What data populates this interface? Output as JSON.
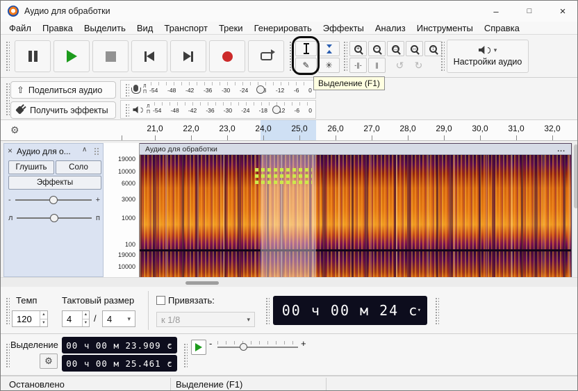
{
  "window": {
    "title": "Аудио для обработки",
    "minimize": "–",
    "maximize": "□",
    "close": "×"
  },
  "menu": {
    "items": [
      "Файл",
      "Правка",
      "Выделить",
      "Вид",
      "Транспорт",
      "Треки",
      "Генерировать",
      "Эффекты",
      "Анализ",
      "Инструменты",
      "Справка"
    ]
  },
  "toolbar": {
    "audio_setup": "Настройки аудио",
    "share_audio": "Поделиться аудио",
    "get_effects": "Получить эффекты",
    "tooltip": "Выделение (F1)"
  },
  "icons": {
    "caret": "▾",
    "spin_up": "▴",
    "spin_down": "▾",
    "gear": "⚙",
    "undo": "↺",
    "redo": "↻",
    "pencil": "✎",
    "star": "✳",
    "share": "⇧",
    "zoom_in": "+",
    "zoom_out": "−",
    "zoom_sel": "▭",
    "zoom_fit": "↔",
    "zoom_tog": "↕",
    "trim": "-∥-",
    "silence": "∥",
    "ellipsis": "...",
    "close_track": "×",
    "collapse": "∧",
    "slash": "/"
  },
  "colors": {
    "play_green": "#1d9b1d",
    "record_red": "#cc2a2a",
    "selection_blue": "#cfe0f4"
  },
  "meters": {
    "channels": [
      "Л",
      "П"
    ],
    "scale": [
      "-54",
      "-48",
      "-42",
      "-36",
      "-30",
      "-24",
      "-18",
      "-12",
      "-6",
      "0"
    ]
  },
  "timeline": {
    "ticks": [
      "21,0",
      "22,0",
      "23,0",
      "24,0",
      "25,0",
      "26,0",
      "27,0",
      "28,0",
      "29,0",
      "30,0",
      "31,0",
      "32,0"
    ]
  },
  "track": {
    "panel_name": "Аудио для о...",
    "mute": "Глушить",
    "solo": "Соло",
    "effects": "Эффекты",
    "gain_min": "-",
    "gain_max": "+",
    "pan_left": "л",
    "pan_right": "п",
    "clip_name": "Аудио для обработки",
    "freq1": [
      "19000",
      "10000",
      "6000",
      "3000",
      "1000",
      "100"
    ],
    "freq2": [
      "19000",
      "10000"
    ]
  },
  "transport_bar": {
    "tempo_label": "Темп",
    "tempo": "120",
    "timesig_label": "Тактовый размер",
    "timesig_upper": "4",
    "timesig_lower": "4",
    "snap_label": "Привязать:",
    "snap_value": "к 1/8",
    "time": "00 ч 00 м 24 с"
  },
  "selection_bar": {
    "label": "Выделение",
    "start": "00 ч 00 м 23.909 с",
    "end": "00 ч 00 м 25.461 с",
    "speed_min": "-",
    "speed_max": "+"
  },
  "status": {
    "state": "Остановлено",
    "tool": "Выделение (F1)"
  }
}
